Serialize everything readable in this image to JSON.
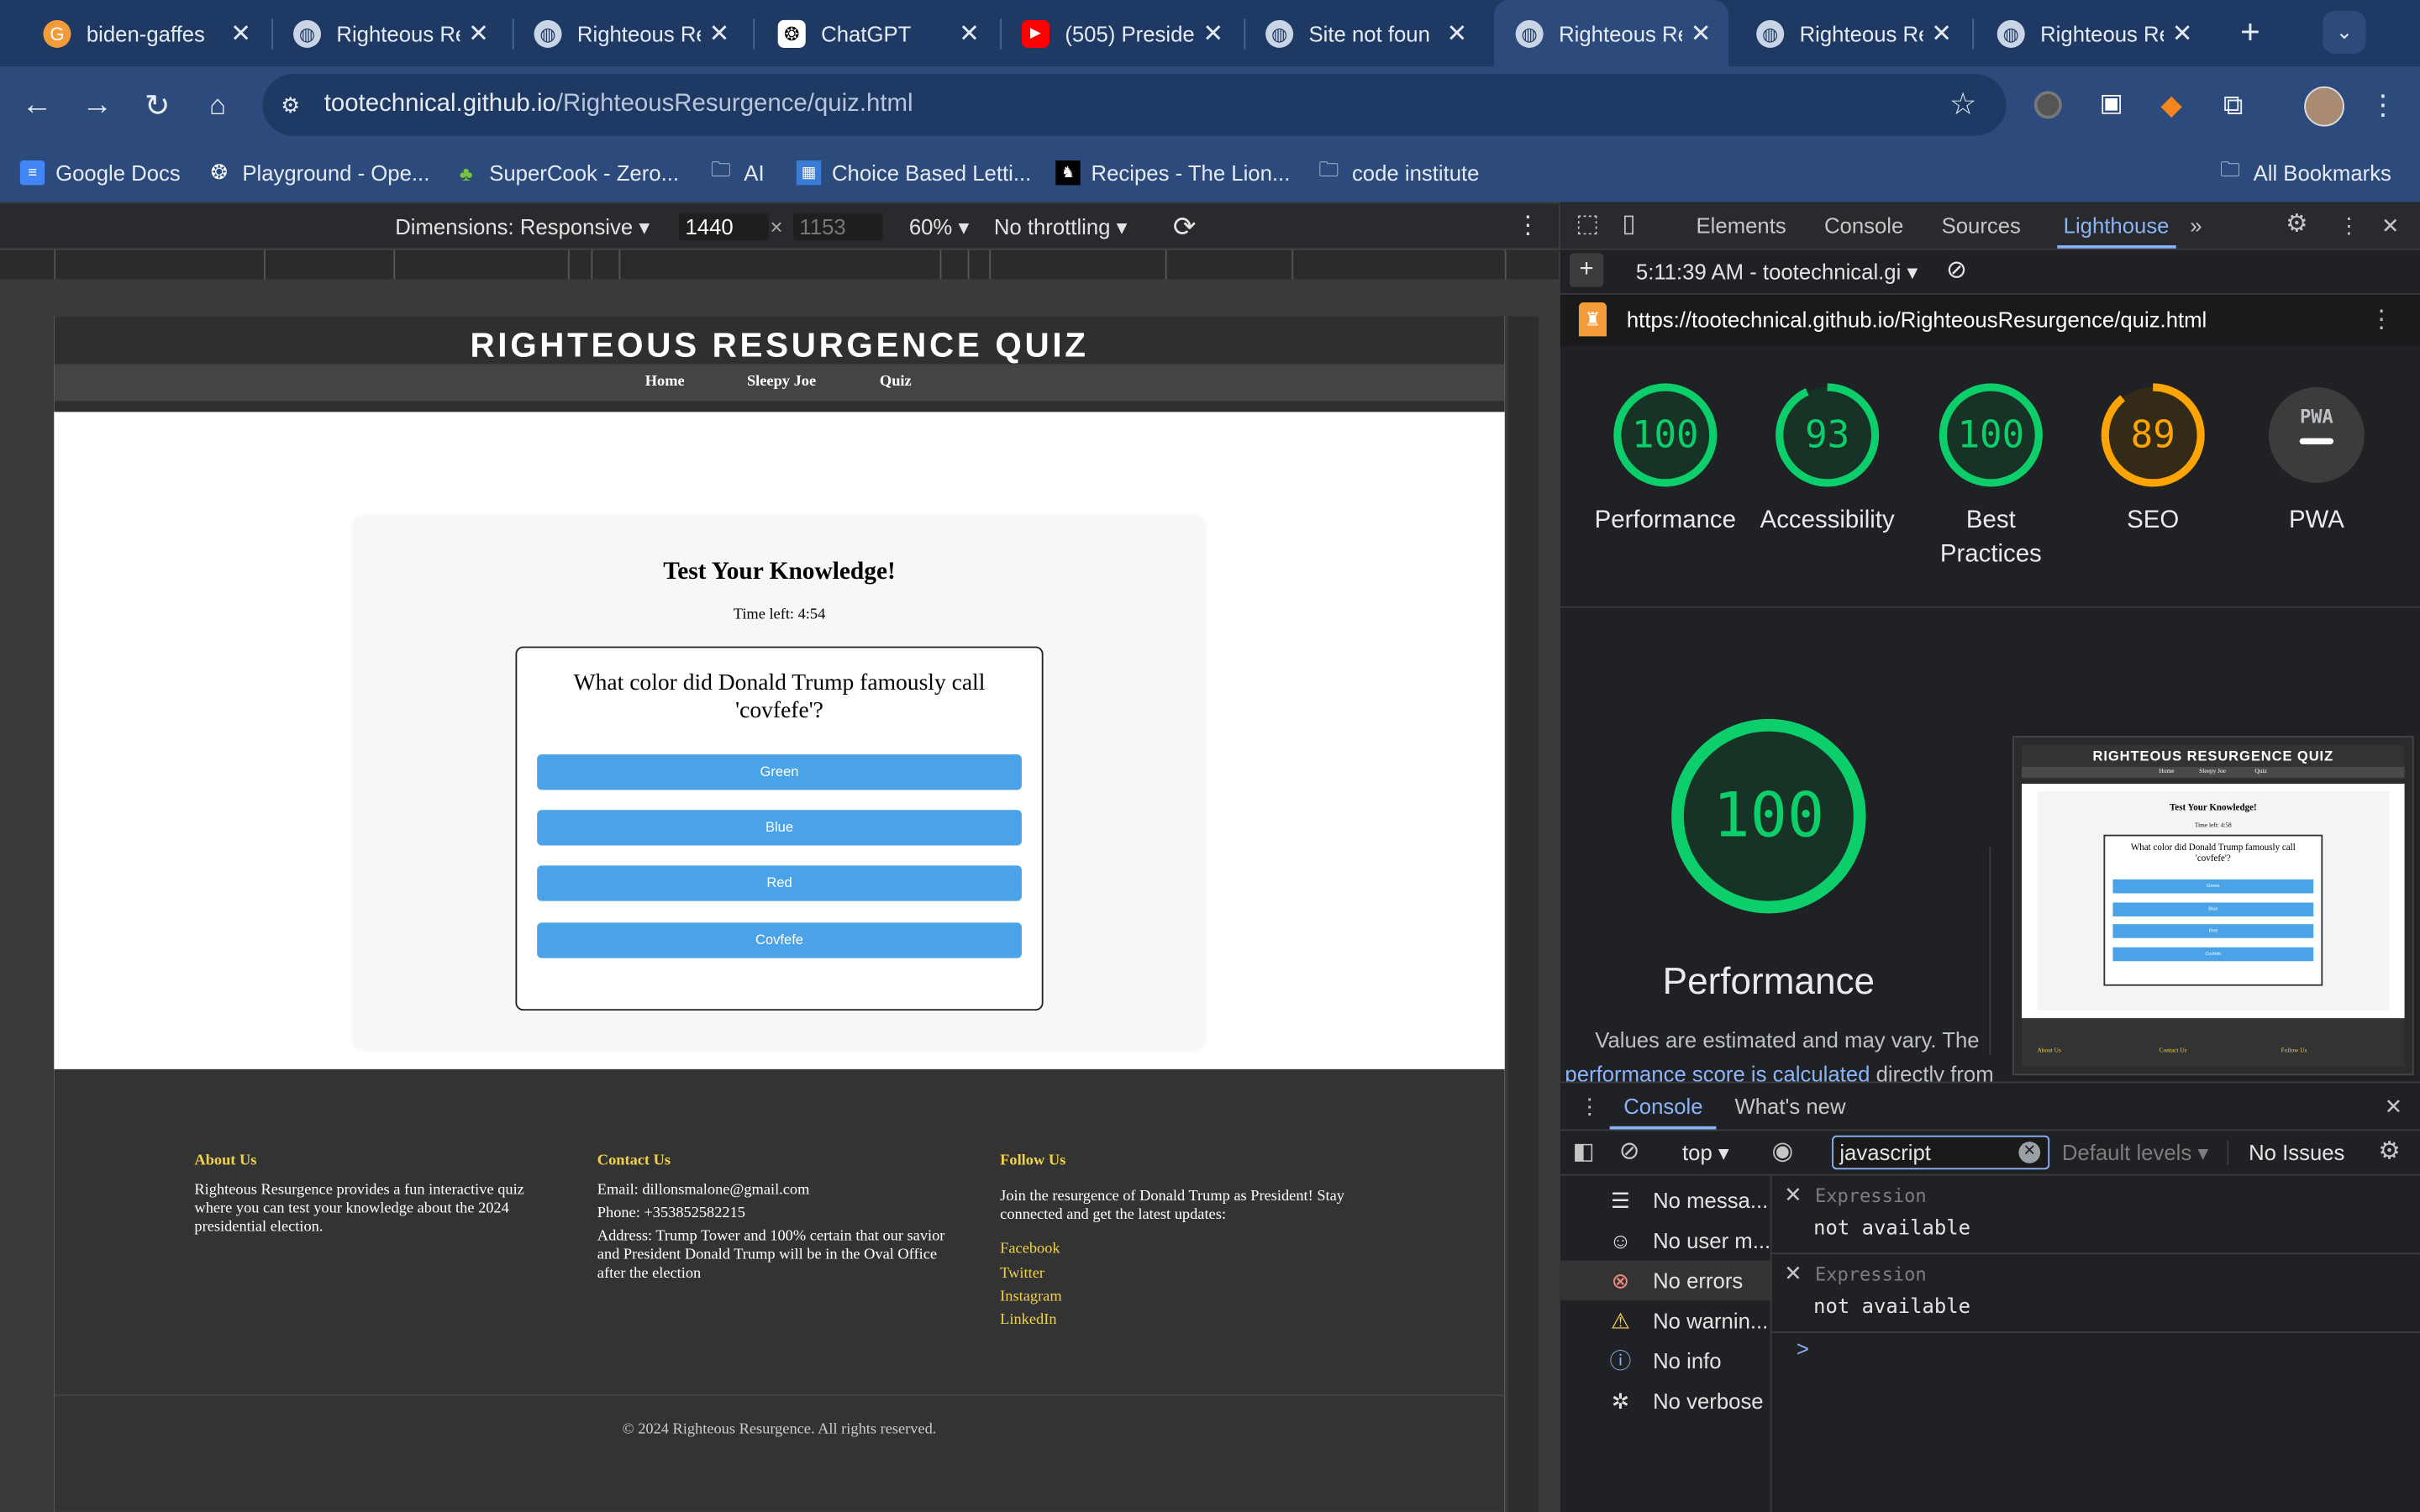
{
  "browser": {
    "tabs": [
      {
        "title": "biden-gaffes",
        "icon": "g-logo-icon"
      },
      {
        "title": "Righteous Re",
        "icon": "globe-icon"
      },
      {
        "title": "Righteous Re",
        "icon": "globe-icon"
      },
      {
        "title": "ChatGPT",
        "icon": "openai-icon"
      },
      {
        "title": "(505) Preside",
        "icon": "youtube-icon"
      },
      {
        "title": "Site not foun",
        "icon": "globe-icon"
      },
      {
        "title": "Righteous Re",
        "icon": "globe-icon"
      },
      {
        "title": "Righteous Re",
        "icon": "globe-icon"
      },
      {
        "title": "Righteous Re",
        "icon": "globe-icon"
      }
    ],
    "url_host": "tootechnical.github.io",
    "url_path": "/RighteousResurgence/quiz.html",
    "bookmarks": [
      "Google Docs",
      "Playground - Ope...",
      "SuperCook - Zero...",
      "AI",
      "Choice Based Letti...",
      "Recipes - The Lion...",
      "code institute"
    ],
    "all_bookmarks": "All Bookmarks"
  },
  "device_toolbar": {
    "dimensions": "Dimensions: Responsive",
    "width": "1440",
    "height": "1153",
    "zoom": "60%",
    "throttling": "No throttling"
  },
  "site": {
    "title": "RIGHTEOUS RESURGENCE QUIZ",
    "nav": [
      "Home",
      "Sleepy Joe",
      "Quiz"
    ],
    "quiz_title": "Test Your Knowledge!",
    "time_left": "Time left: 4:54",
    "question": "What color did Donald Trump famously call 'covfefe'?",
    "answers": [
      "Green",
      "Blue",
      "Red",
      "Covfefe"
    ],
    "footer": {
      "about_heading": "About Us",
      "about_text": "Righteous Resurgence provides a fun interactive quiz where you can test your knowledge about the 2024 presidential election.",
      "contact_heading": "Contact Us",
      "email": "Email: dillonsmalone@gmail.com",
      "phone": "Phone: +353852582215",
      "address": "Address: Trump Tower and 100% certain that our savior and President Donald Trump will be in the Oval Office after the election",
      "follow_heading": "Follow Us",
      "follow_text": "Join the resurgence of Donald Trump as President! Stay connected and get the latest updates:",
      "links": [
        "Facebook",
        "Twitter",
        "Instagram",
        "LinkedIn"
      ],
      "copyright": "© 2024 Righteous Resurgence. All rights reserved."
    }
  },
  "devtools": {
    "tabs": [
      "Elements",
      "Console",
      "Sources",
      "Lighthouse"
    ],
    "active_tab": "Lighthouse",
    "report_time": "5:11:39 AM - tootechnical.gi",
    "report_url": "https://tootechnical.github.io/RighteousResurgence/quiz.html",
    "scores": [
      {
        "label": "Performance",
        "value": "100",
        "fraction": 1.0,
        "color": "#0cce6b"
      },
      {
        "label": "Accessibility",
        "value": "93",
        "fraction": 0.93,
        "color": "#0cce6b"
      },
      {
        "label": "Best Practices",
        "value": "100",
        "fraction": 1.0,
        "color": "#0cce6b"
      },
      {
        "label": "SEO",
        "value": "89",
        "fraction": 0.89,
        "color": "#ffa400"
      },
      {
        "label": "PWA",
        "value": "PWA",
        "fraction": 0,
        "color": "#9aa0a6"
      }
    ],
    "big_score": "100",
    "big_label": "Performance",
    "estimate_text": "Values are estimated and may vary. The",
    "estimate_link": "performance score is calculated",
    "estimate_tail": "directly from",
    "thumb": {
      "title": "RIGHTEOUS RESURGENCE QUIZ",
      "nav": [
        "Home",
        "Sleepy Joe",
        "Quiz"
      ],
      "quiz_title": "Test Your Knowledge!",
      "time_left": "Time left: 4:58",
      "question": "What color did Donald Trump famously call 'covfefe'?",
      "answers": [
        "Green",
        "Blue",
        "Red",
        "Covfefe"
      ],
      "footer": [
        "About Us",
        "Contact Us",
        "Follow Us"
      ]
    },
    "drawer_tabs": [
      "Console",
      "What's new"
    ],
    "context": "top",
    "filter": "javascript",
    "levels": "Default levels",
    "issues": "No Issues",
    "sidebar": [
      {
        "label": "No messa...",
        "icon": "list-icon"
      },
      {
        "label": "No user m...",
        "icon": "user-icon"
      },
      {
        "label": "No errors",
        "icon": "error-icon"
      },
      {
        "label": "No warnin...",
        "icon": "warning-icon"
      },
      {
        "label": "No info",
        "icon": "info-icon"
      },
      {
        "label": "No verbose",
        "icon": "bug-icon"
      }
    ],
    "expressions": [
      {
        "label": "Expression",
        "value": "not available"
      },
      {
        "label": "Expression",
        "value": "not available"
      }
    ],
    "prompt": ">"
  }
}
